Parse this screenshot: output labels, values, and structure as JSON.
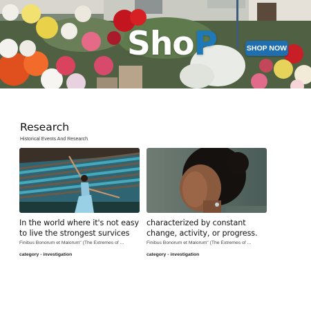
{
  "banner": {
    "logo_part1": "Sho",
    "logo_part2": "P",
    "cta_label": "SHOP NOW"
  },
  "section": {
    "title": "Research",
    "subtitle": "Historical Events And Research"
  },
  "cards": [
    {
      "title": "In the world where it's not easy to live the strongest survices",
      "excerpt": "Finibus Bonorum et Malorum\" (The Extremes of ...",
      "category": "category - investigation"
    },
    {
      "title": "characterized by constant change, activity, or progress.",
      "excerpt": "Finibus Bonorum et Malorum\" (The Extremes of ...",
      "category": "category - investigation"
    }
  ],
  "colors": {
    "accent": "#1f6fb0",
    "logo_blue": "#1f78b8"
  }
}
